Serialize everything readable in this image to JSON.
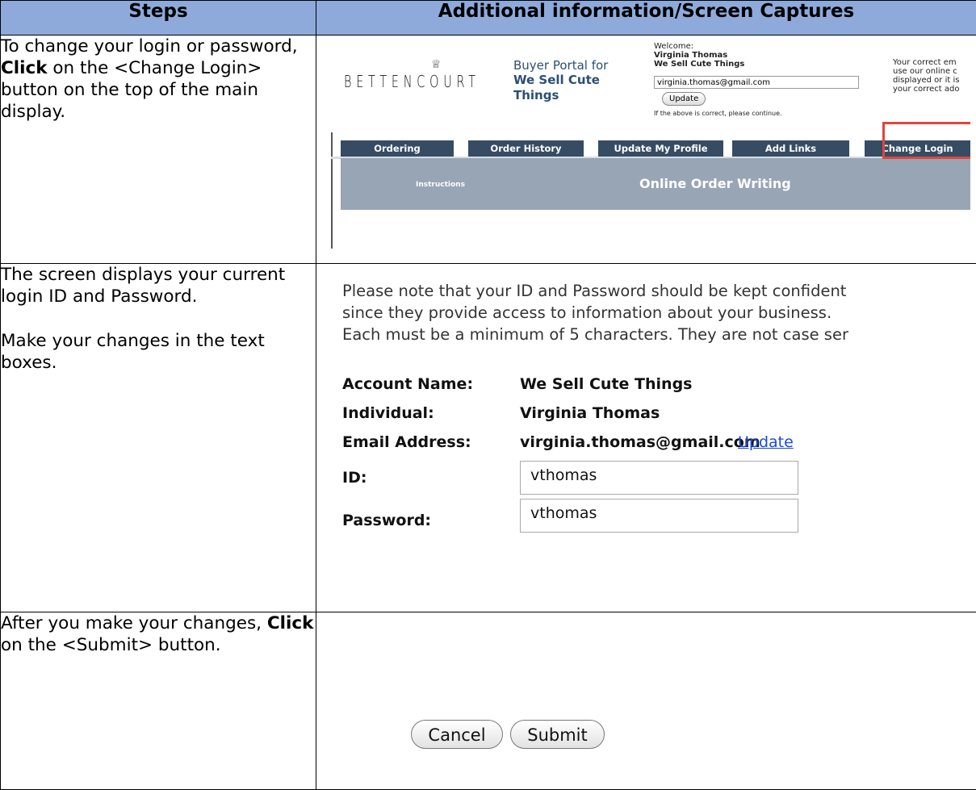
{
  "table": {
    "headers": {
      "steps": "Steps",
      "info": "Additional information/Screen Captures"
    },
    "rows": [
      {
        "step": [
          {
            "t": "To change your login or password, "
          },
          {
            "t": "Click",
            "b": true
          },
          {
            "t": " on the <Change Login> button on the top of the main display."
          }
        ]
      },
      {
        "step_a": "The screen displays your current login ID and Password.",
        "step_b": "Make your changes in the text boxes."
      },
      {
        "step": [
          {
            "t": "After you make your changes, "
          },
          {
            "t": "Click",
            "b": true
          },
          {
            "t": " on the <Submit> button."
          }
        ]
      }
    ]
  },
  "capture1": {
    "logo": "BETTENCOURT",
    "crown_glyph": "♕",
    "portal_for": "Buyer Portal for",
    "portal_name": "We Sell Cute Things",
    "welcome": "Welcome:",
    "welcome_name": "Virginia  Thomas",
    "welcome_company": "We Sell Cute Things",
    "email": "virginia.thomas@gmail.com",
    "update_button": "Update",
    "note": "If the above is correct, please continue.",
    "right_note": [
      "Your correct em",
      "use our online c",
      "displayed or it is",
      "your correct ado"
    ],
    "nav": [
      "Ordering",
      "Order History",
      "Update My Profile",
      "Add Links",
      "Change Login"
    ],
    "band_instructions": "Instructions",
    "band_title": "Online Order Writing",
    "highlight_color": "#e0463b",
    "nav_color": "#364c63"
  },
  "capture2": {
    "notice": [
      "Please note that your ID and Password should be kept confident",
      "since they provide access to information about your business.",
      "Each must be a minimum of 5 characters. They are not case ser"
    ],
    "account_label": "Account Name:",
    "account_value": "We Sell Cute Things",
    "individual_label": "Individual:",
    "individual_value": "Virginia Thomas",
    "email_label": "Email Address:",
    "email_value": "virginia.thomas@gmail.com",
    "update_link": "Update",
    "id_label": "ID:",
    "id_value": "vthomas",
    "password_label": "Password:",
    "password_value": "vthomas"
  },
  "capture3": {
    "cancel": "Cancel",
    "submit": "Submit"
  }
}
